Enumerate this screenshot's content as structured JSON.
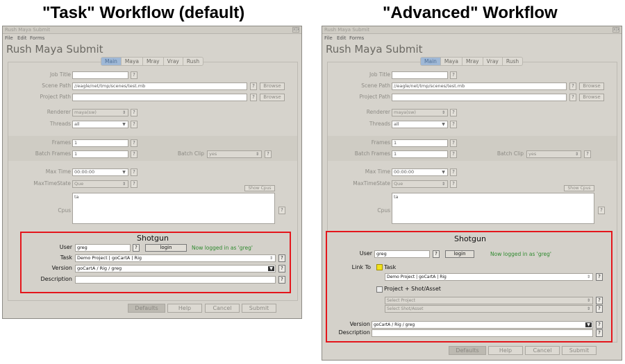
{
  "headings": {
    "left": "\"Task\" Workflow (default)",
    "right": "\"Advanced\" Workflow"
  },
  "window": {
    "title": "Rush Maya Submit",
    "close": "x|x",
    "menu": [
      "File",
      "Edit",
      "Forms"
    ],
    "app_title": "Rush Maya Submit",
    "tabs": [
      "Main",
      "Maya",
      "Mray",
      "Vray",
      "Rush"
    ],
    "active_tab": "Main"
  },
  "form": {
    "job_title_label": "Job Title",
    "job_title_value": "",
    "scene_path_label": "Scene Path",
    "scene_path_value": "//eagle/net/tmp/scenes/test.mb",
    "project_path_label": "Project Path",
    "project_path_value": "",
    "browse_label": "Browse",
    "renderer_label": "Renderer",
    "renderer_value": "maya(sw)",
    "threads_label": "Threads",
    "threads_value": "all",
    "frames_label": "Frames",
    "frames_value": "1",
    "batch_frames_label": "Batch Frames",
    "batch_frames_value": "1",
    "batch_clip_label": "Batch Clip",
    "batch_clip_value": "yes",
    "max_time_label": "Max Time",
    "max_time_value": "00:00:00",
    "max_time_state_label": "MaxTimeState",
    "max_time_state_value": "Que",
    "show_cpus_label": "Show Cpus",
    "cpus_label": "Cpus",
    "cpus_value": "ta",
    "help": "?",
    "spin": "⇕",
    "drop": "▼"
  },
  "shotgun": {
    "title": "Shotgun",
    "user_label": "User",
    "user_value": "greg",
    "login_label": "login",
    "logged_in_msg": "Now logged in as 'greg'",
    "task_label": "Task",
    "task_value": "Demo Project | goCartA | Rig",
    "version_label": "Version",
    "version_value": "goCartA / Rig / greg",
    "description_label": "Description",
    "description_value": "",
    "link_to_label": "Link To",
    "task_option_label": "Task",
    "project_shot_label": "Project + Shot/Asset",
    "select_project_placeholder": "Select Project",
    "select_shot_placeholder": "Select Shot/Asset"
  },
  "buttons": {
    "defaults": "Defaults",
    "help": "Help",
    "cancel": "Cancel",
    "submit": "Submit"
  },
  "colors": {
    "highlight_border": "#e4151b",
    "logged_in_text": "#2f8a2f",
    "active_tab": "#9fb8d6",
    "task_checkbox": "#f2e21c"
  }
}
